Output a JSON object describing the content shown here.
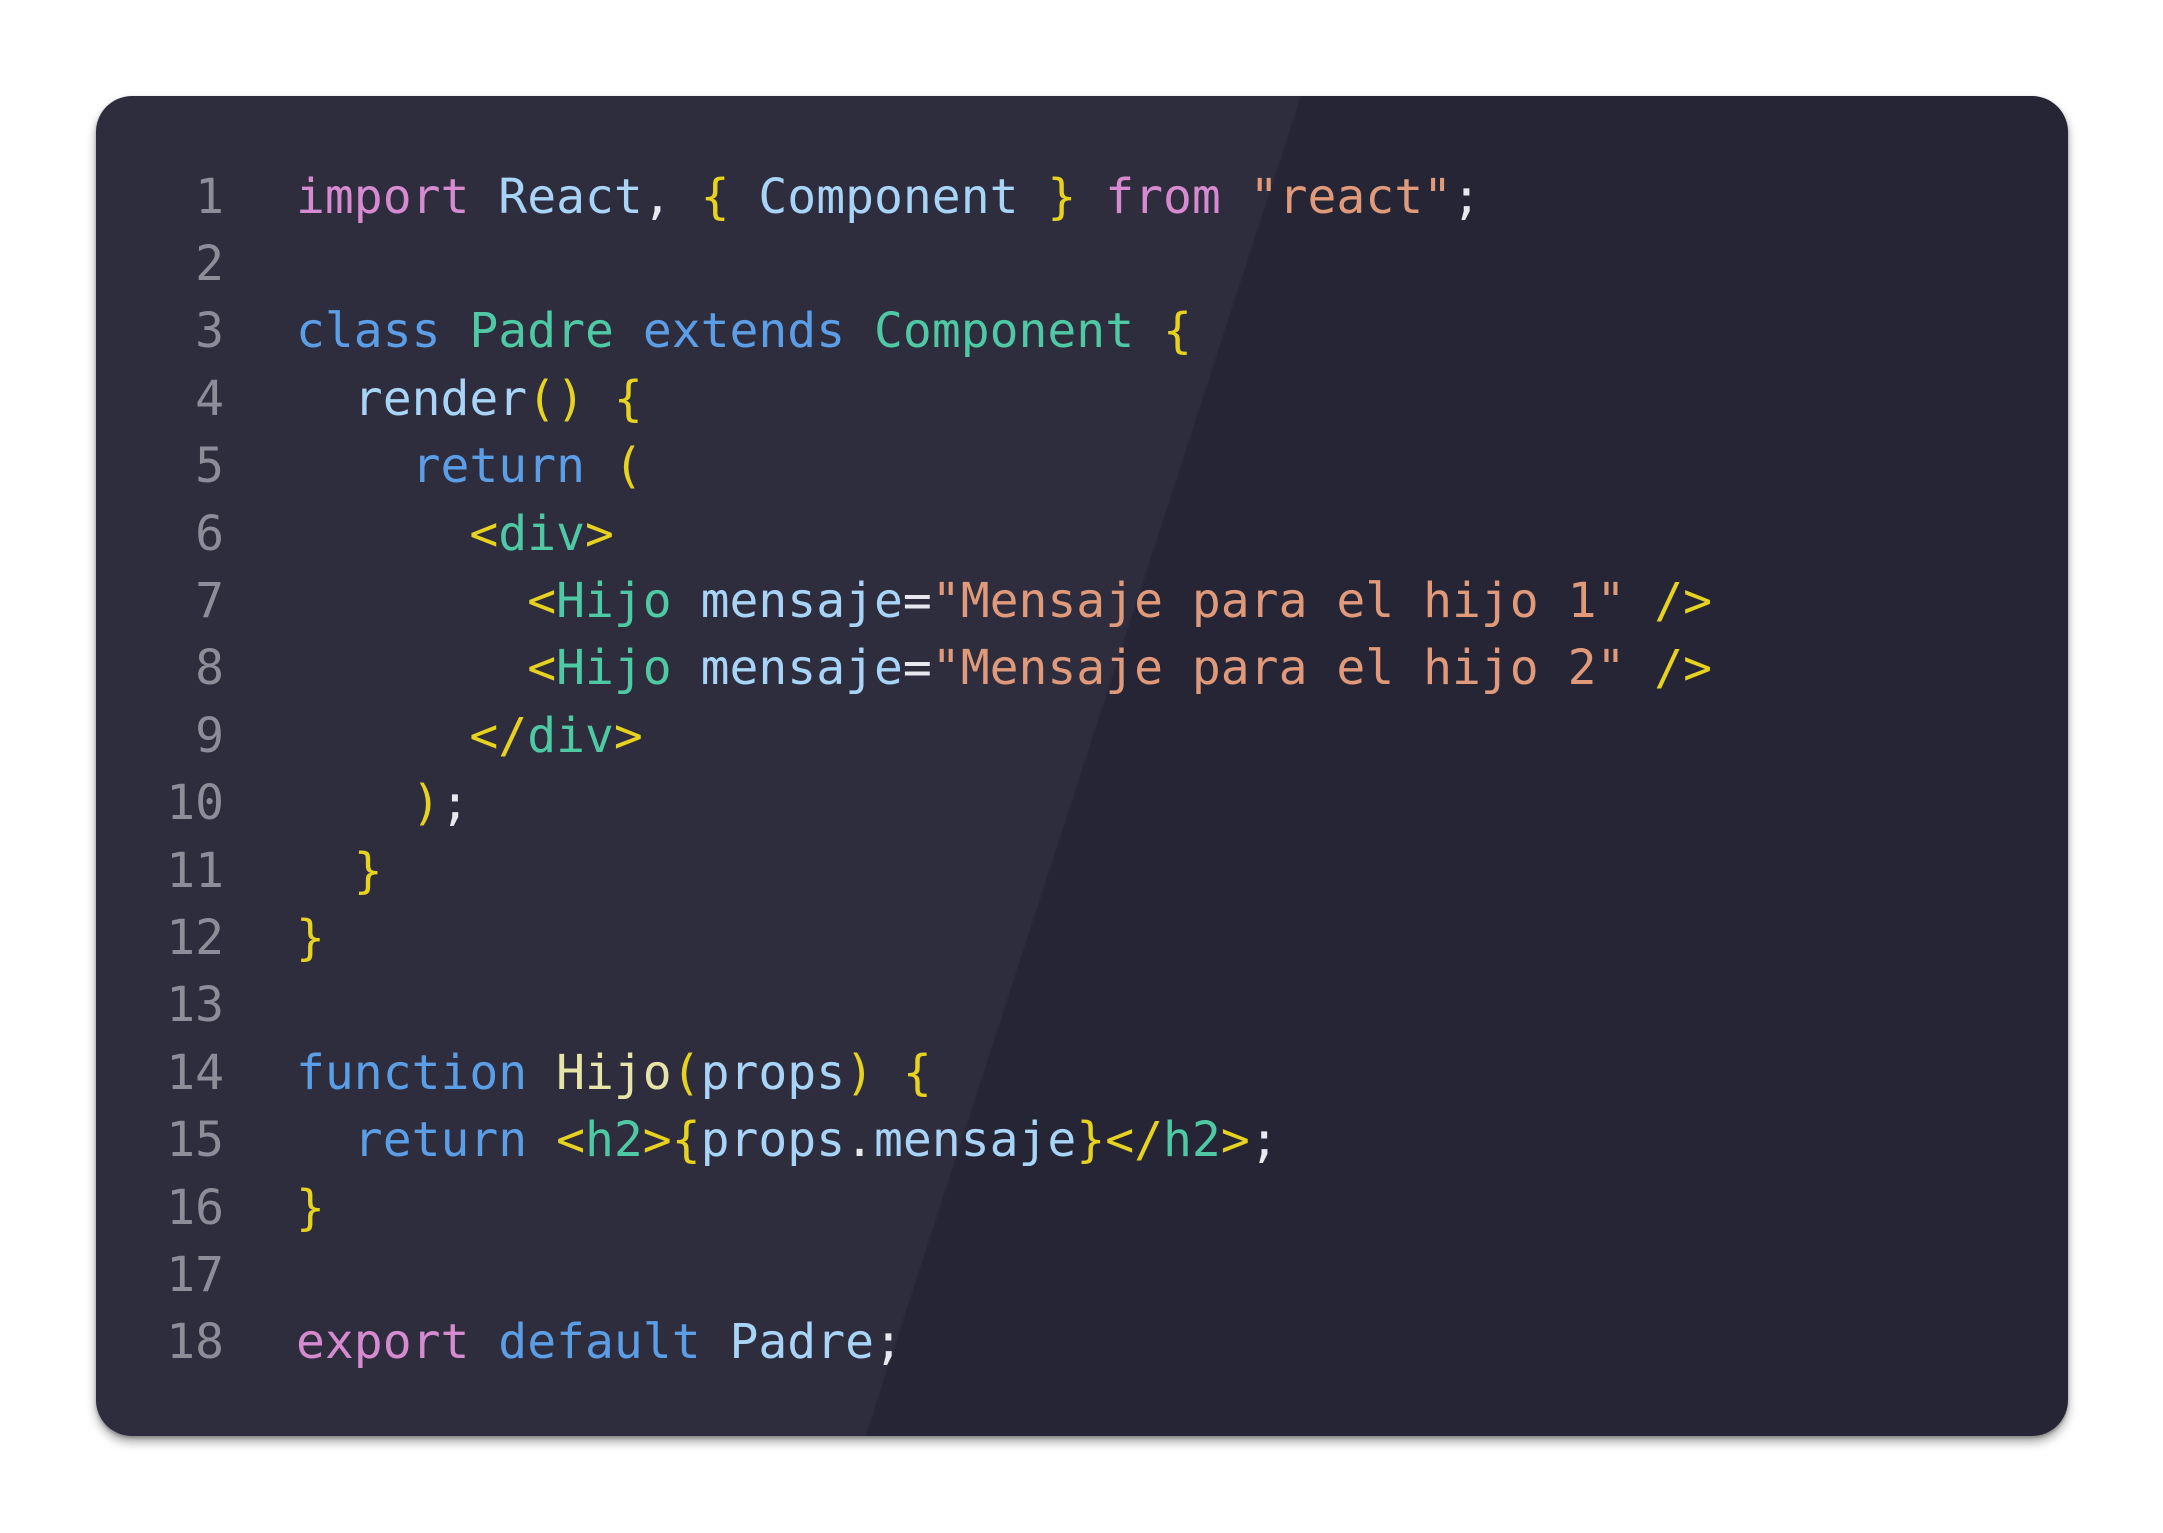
{
  "editor": {
    "lines": [
      {
        "n": "1",
        "tokens": [
          {
            "t": "import",
            "c": "kw-pink"
          },
          {
            "t": " ",
            "c": "punc"
          },
          {
            "t": "React",
            "c": "id-light"
          },
          {
            "t": ", ",
            "c": "punc"
          },
          {
            "t": "{",
            "c": "brace"
          },
          {
            "t": " ",
            "c": "punc"
          },
          {
            "t": "Component",
            "c": "id-light"
          },
          {
            "t": " ",
            "c": "punc"
          },
          {
            "t": "}",
            "c": "brace"
          },
          {
            "t": " ",
            "c": "punc"
          },
          {
            "t": "from",
            "c": "kw-pink"
          },
          {
            "t": " ",
            "c": "punc"
          },
          {
            "t": "\"react\"",
            "c": "str"
          },
          {
            "t": ";",
            "c": "punc"
          }
        ]
      },
      {
        "n": "2",
        "tokens": []
      },
      {
        "n": "3",
        "tokens": [
          {
            "t": "class",
            "c": "kw-blue"
          },
          {
            "t": " ",
            "c": "punc"
          },
          {
            "t": "Padre",
            "c": "cls"
          },
          {
            "t": " ",
            "c": "punc"
          },
          {
            "t": "extends",
            "c": "kw-blue"
          },
          {
            "t": " ",
            "c": "punc"
          },
          {
            "t": "Component",
            "c": "cls"
          },
          {
            "t": " ",
            "c": "punc"
          },
          {
            "t": "{",
            "c": "brace"
          }
        ]
      },
      {
        "n": "4",
        "tokens": [
          {
            "t": "  ",
            "c": "punc"
          },
          {
            "t": "render",
            "c": "id-light"
          },
          {
            "t": "()",
            "c": "brace"
          },
          {
            "t": " ",
            "c": "punc"
          },
          {
            "t": "{",
            "c": "brace"
          }
        ]
      },
      {
        "n": "5",
        "tokens": [
          {
            "t": "    ",
            "c": "punc"
          },
          {
            "t": "return",
            "c": "kw-blue"
          },
          {
            "t": " ",
            "c": "punc"
          },
          {
            "t": "(",
            "c": "brace"
          }
        ]
      },
      {
        "n": "6",
        "tokens": [
          {
            "t": "      ",
            "c": "punc"
          },
          {
            "t": "<",
            "c": "brace"
          },
          {
            "t": "div",
            "c": "cls"
          },
          {
            "t": ">",
            "c": "brace"
          }
        ]
      },
      {
        "n": "7",
        "tokens": [
          {
            "t": "        ",
            "c": "punc"
          },
          {
            "t": "<",
            "c": "brace"
          },
          {
            "t": "Hijo",
            "c": "cls"
          },
          {
            "t": " ",
            "c": "punc"
          },
          {
            "t": "mensaje",
            "c": "id-light"
          },
          {
            "t": "=",
            "c": "punc"
          },
          {
            "t": "\"Mensaje para el hijo 1\"",
            "c": "str"
          },
          {
            "t": " ",
            "c": "punc"
          },
          {
            "t": "/>",
            "c": "brace"
          }
        ]
      },
      {
        "n": "8",
        "tokens": [
          {
            "t": "        ",
            "c": "punc"
          },
          {
            "t": "<",
            "c": "brace"
          },
          {
            "t": "Hijo",
            "c": "cls"
          },
          {
            "t": " ",
            "c": "punc"
          },
          {
            "t": "mensaje",
            "c": "id-light"
          },
          {
            "t": "=",
            "c": "punc"
          },
          {
            "t": "\"Mensaje para el hijo 2\"",
            "c": "str"
          },
          {
            "t": " ",
            "c": "punc"
          },
          {
            "t": "/>",
            "c": "brace"
          }
        ]
      },
      {
        "n": "9",
        "tokens": [
          {
            "t": "      ",
            "c": "punc"
          },
          {
            "t": "</",
            "c": "brace"
          },
          {
            "t": "div",
            "c": "cls"
          },
          {
            "t": ">",
            "c": "brace"
          }
        ]
      },
      {
        "n": "10",
        "tokens": [
          {
            "t": "    ",
            "c": "punc"
          },
          {
            "t": ")",
            "c": "brace"
          },
          {
            "t": ";",
            "c": "punc"
          }
        ]
      },
      {
        "n": "11",
        "tokens": [
          {
            "t": "  ",
            "c": "punc"
          },
          {
            "t": "}",
            "c": "brace"
          }
        ]
      },
      {
        "n": "12",
        "tokens": [
          {
            "t": "}",
            "c": "brace"
          }
        ]
      },
      {
        "n": "13",
        "tokens": []
      },
      {
        "n": "14",
        "tokens": [
          {
            "t": "function",
            "c": "kw-blue"
          },
          {
            "t": " ",
            "c": "punc"
          },
          {
            "t": "Hijo",
            "c": "fn"
          },
          {
            "t": "(",
            "c": "brace"
          },
          {
            "t": "props",
            "c": "id-light"
          },
          {
            "t": ")",
            "c": "brace"
          },
          {
            "t": " ",
            "c": "punc"
          },
          {
            "t": "{",
            "c": "brace"
          }
        ]
      },
      {
        "n": "15",
        "tokens": [
          {
            "t": "  ",
            "c": "punc"
          },
          {
            "t": "return",
            "c": "kw-blue"
          },
          {
            "t": " ",
            "c": "punc"
          },
          {
            "t": "<",
            "c": "brace"
          },
          {
            "t": "h2",
            "c": "cls"
          },
          {
            "t": ">",
            "c": "brace"
          },
          {
            "t": "{",
            "c": "brace"
          },
          {
            "t": "props",
            "c": "id-light"
          },
          {
            "t": ".",
            "c": "punc"
          },
          {
            "t": "mensaje",
            "c": "id-light"
          },
          {
            "t": "}",
            "c": "brace"
          },
          {
            "t": "</",
            "c": "brace"
          },
          {
            "t": "h2",
            "c": "cls"
          },
          {
            "t": ">",
            "c": "brace"
          },
          {
            "t": ";",
            "c": "punc"
          }
        ]
      },
      {
        "n": "16",
        "tokens": [
          {
            "t": "}",
            "c": "brace"
          }
        ]
      },
      {
        "n": "17",
        "tokens": []
      },
      {
        "n": "18",
        "tokens": [
          {
            "t": "export",
            "c": "kw-pink"
          },
          {
            "t": " ",
            "c": "punc"
          },
          {
            "t": "default",
            "c": "kw-blue"
          },
          {
            "t": " ",
            "c": "punc"
          },
          {
            "t": "Padre",
            "c": "id-light"
          },
          {
            "t": ";",
            "c": "punc"
          }
        ]
      }
    ]
  },
  "theme": {
    "background": "#262536",
    "line_number": "#8d8d99",
    "keyword_pink": "#d68bd0",
    "keyword_blue": "#5b9ee6",
    "identifier": "#a8d4f7",
    "brace": "#e6d21f",
    "string": "#e09a7a",
    "class_tag": "#4ec9a4",
    "function_name": "#e6e4a6",
    "punctuation": "#e8e8ee"
  }
}
